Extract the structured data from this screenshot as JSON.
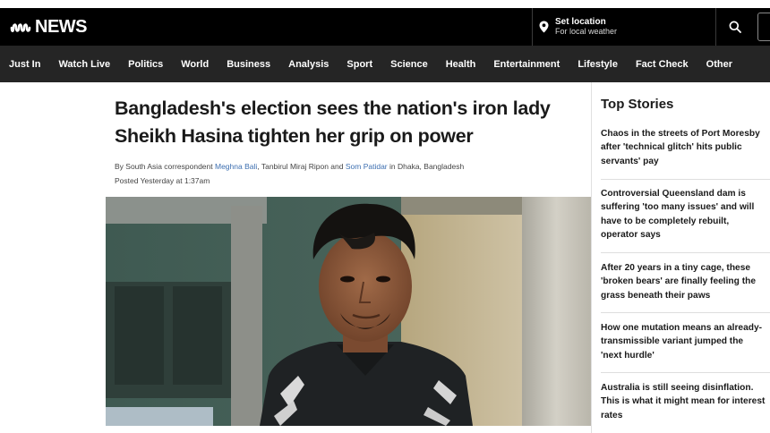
{
  "header": {
    "logo_text": "NEWS",
    "location": {
      "title": "Set location",
      "subtitle": "For local weather"
    }
  },
  "nav": {
    "items": [
      "Just In",
      "Watch Live",
      "Politics",
      "World",
      "Business",
      "Analysis",
      "Sport",
      "Science",
      "Health",
      "Entertainment",
      "Lifestyle",
      "Fact Check",
      "Other"
    ]
  },
  "article": {
    "headline": "Bangladesh's election sees the nation's iron lady Sheikh Hasina tighten her grip on power",
    "byline": {
      "prefix": "By South Asia correspondent ",
      "author1": "Meghna Bali",
      "middle": ", Tanbirul Miraj Ripon and ",
      "author2": "Som Patidar",
      "suffix": " in Dhaka, Bangladesh"
    },
    "posted": "Posted Yesterday at 1:37am"
  },
  "sidebar": {
    "title": "Top Stories",
    "stories": [
      "Chaos in the streets of Port Moresby after 'technical glitch' hits public servants' pay",
      "Controversial Queensland dam is suffering 'too many issues' and will have to be completely rebuilt, operator says",
      "After 20 years in a tiny cage, these 'broken bears' are finally feeling the grass beneath their paws",
      "How one mutation means an already-transmissible variant jumped the 'next hurdle'",
      "Australia is still seeing disinflation. This is what it might mean for interest rates"
    ]
  },
  "colors": {
    "header_bg": "#000000",
    "nav_bg": "#252525",
    "link": "#3d6fb0"
  },
  "icons": [
    "abc-logo-icon",
    "location-pin-icon",
    "search-icon"
  ]
}
